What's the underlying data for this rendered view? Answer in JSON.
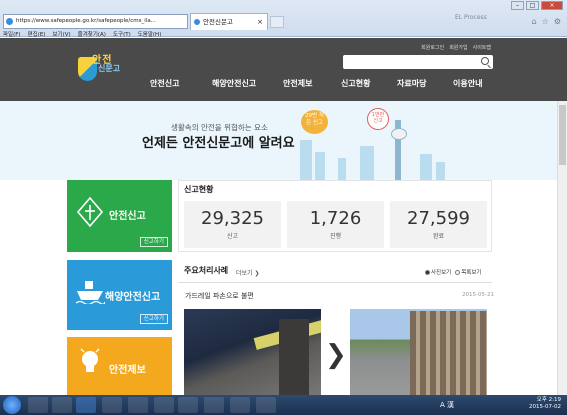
{
  "browser": {
    "url": "https://www.safepeople.go.kr/safepeople/cms_ila...",
    "tab_title": "안전신문고",
    "tab_close": "×",
    "bg_tab": "EL Process",
    "menu": [
      "파일(F)",
      "편집(E)",
      "보기(V)",
      "즐겨찾기(A)",
      "도구(T)",
      "도움말(H)"
    ]
  },
  "site": {
    "logo_line1": "안전",
    "logo_line2": "신문고",
    "util_links": [
      "회원로그인",
      "회원가입",
      "사이트맵"
    ],
    "search_placeholder": "",
    "nav": [
      "안전신고",
      "해양안전신고",
      "안전제보",
      "신고현황",
      "자료마당",
      "이용안내"
    ]
  },
  "banner": {
    "line1": "생활속의 안전을 위협하는 요소",
    "line2": "언제든 안전신문고에 알려요",
    "badge1": "29번 적은 신고",
    "badge2": "1번만 신고"
  },
  "features": [
    {
      "label": "안전신고",
      "button": "신고하기"
    },
    {
      "label": "해양안전신고",
      "button": "신고하기"
    },
    {
      "label": "안전제보",
      "button": ""
    }
  ],
  "stats": {
    "title": "신고현황",
    "items": [
      {
        "value": "29,325",
        "label": "신고"
      },
      {
        "value": "1,726",
        "label": "진행"
      },
      {
        "value": "27,599",
        "label": "완료"
      }
    ]
  },
  "cases": {
    "title": "주요처리사례",
    "more": "더보기 ❯",
    "sort": [
      "사진보기",
      "목록보기"
    ],
    "item_title": "가드레일 파손으로 불편",
    "item_date": "2015-05-21",
    "arrow": "❯"
  },
  "taskbar": {
    "tray": "A 漢",
    "time": "오후 2:19",
    "date": "2015-07-02"
  }
}
